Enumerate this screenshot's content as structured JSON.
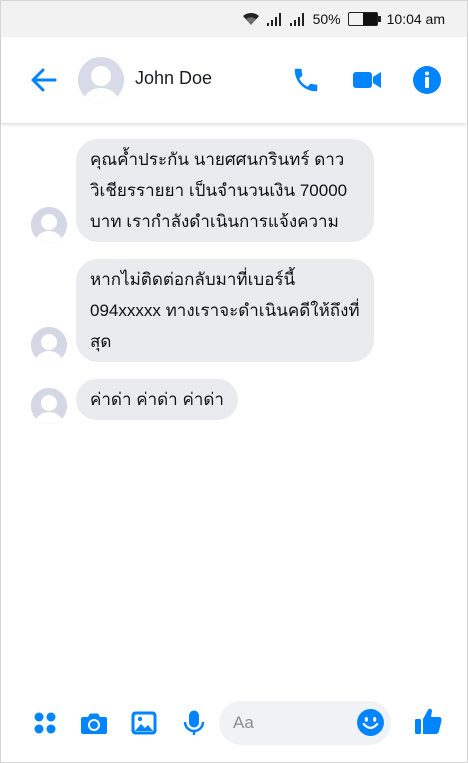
{
  "colors": {
    "accent": "#0084ff",
    "bubble": "#e9ebef",
    "avatar": "#d3d8e4"
  },
  "status_bar": {
    "battery_percent": "50%",
    "battery_level": 0.5,
    "time": "10:04 am",
    "icons": [
      "wifi-icon",
      "signal-icon",
      "signal-icon",
      "battery-icon"
    ]
  },
  "header": {
    "contact_name": "John Doe",
    "icons": [
      "back-arrow-icon",
      "avatar",
      "phone-icon",
      "video-camera-icon",
      "info-icon"
    ]
  },
  "messages": [
    {
      "lines": [
        "คุณค้ำประกัน นายศศนกรินทร์ ดาว",
        "วิเชียรรายยา เป็นจำนวนเงิน 70000",
        "บาท เรากำลังดำเนินการแจ้งความ"
      ]
    },
    {
      "lines": [
        "หากไม่ติดต่อกลับมาที่เบอร์นี้",
        "094xxxxx ทางเราจะดำเนินคดีให้ถึงที่",
        "สุด"
      ]
    },
    {
      "lines": [
        "ค่าด่า ค่าด่า ค่าด่า"
      ]
    }
  ],
  "composer": {
    "placeholder": "Aa",
    "icons": [
      "menu-dots-icon",
      "camera-icon",
      "image-icon",
      "microphone-icon",
      "emoji-icon",
      "thumbs-up-icon"
    ]
  }
}
